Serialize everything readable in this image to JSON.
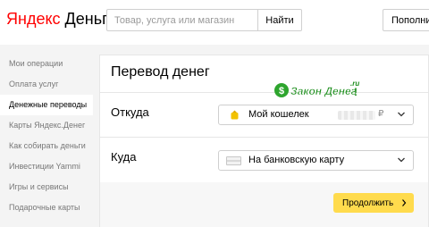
{
  "header": {
    "logo_ya": "Яндекс",
    "logo_dengi": "Деньги",
    "search_placeholder": "Товар, услуга или магазин",
    "search_button": "Найти",
    "topup_button": "Пополни"
  },
  "sidebar": {
    "items": [
      {
        "label": "Мои операции",
        "active": false
      },
      {
        "label": "Оплата услуг",
        "active": false
      },
      {
        "label": "Денежные переводы",
        "active": true
      },
      {
        "label": "Карты Яндекс.Денег",
        "active": false
      },
      {
        "label": "Как собирать деньги",
        "active": false
      },
      {
        "label": "Инвестиции Yammi",
        "active": false
      },
      {
        "label": "Игры и сервисы",
        "active": false
      },
      {
        "label": "Подарочные карты",
        "active": false
      }
    ]
  },
  "transfer": {
    "title": "Перевод денег",
    "from_label": "Откуда",
    "from_value": "Мой кошелек",
    "currency": "₽",
    "to_label": "Куда",
    "to_value": "На банковскую карту",
    "continue_button": "Продолжить"
  },
  "watermark": {
    "text": "Закон Денег",
    "suffix": ".ru"
  },
  "colors": {
    "logo_red": "#ff0000",
    "accent_yellow": "#ffdb4d",
    "watermark_green": "#2ea52e"
  }
}
